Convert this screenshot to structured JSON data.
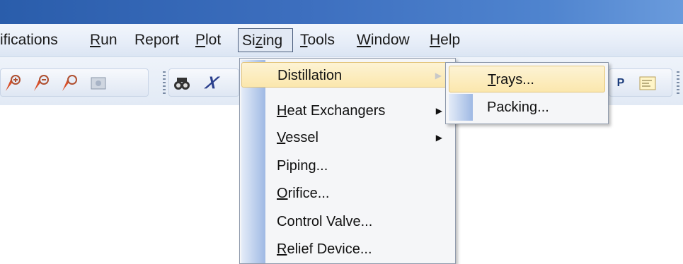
{
  "menubar": {
    "items": [
      {
        "pre": "ifications",
        "ul": "",
        "post": ""
      },
      {
        "pre": "",
        "ul": "R",
        "post": "un"
      },
      {
        "pre": "Report",
        "ul": "",
        "post": ""
      },
      {
        "pre": "",
        "ul": "P",
        "post": "lot"
      },
      {
        "pre": "Si",
        "ul": "z",
        "post": "ing"
      },
      {
        "pre": "",
        "ul": "T",
        "post": "ools"
      },
      {
        "pre": "",
        "ul": "W",
        "post": "indow"
      },
      {
        "pre": "",
        "ul": "H",
        "post": "elp"
      }
    ]
  },
  "toolbar": {
    "icons": [
      "zoom-in-icon",
      "zoom-out-icon",
      "zoom-icon",
      "screenshot-icon",
      "binoculars-icon",
      "variable-icon",
      "p-icon",
      "notes-icon"
    ]
  },
  "sizing_menu": {
    "items": [
      {
        "pre": "Distillation",
        "ul": "",
        "post": "",
        "arrow": "▶"
      },
      {
        "pre": "",
        "ul": "H",
        "post": "eat Exchangers",
        "arrow": "▶"
      },
      {
        "pre": "",
        "ul": "V",
        "post": "essel",
        "arrow": "▶"
      },
      {
        "pre": "Piping...",
        "ul": "",
        "post": "",
        "arrow": ""
      },
      {
        "pre": "",
        "ul": "O",
        "post": "rifice...",
        "arrow": ""
      },
      {
        "pre": "Control Valve...",
        "ul": "",
        "post": "",
        "arrow": ""
      },
      {
        "pre": "",
        "ul": "R",
        "post": "elief Device...",
        "arrow": ""
      }
    ]
  },
  "distillation_submenu": {
    "items": [
      {
        "pre": "",
        "ul": "T",
        "post": "rays..."
      },
      {
        "pre": "Packing...",
        "ul": "",
        "post": ""
      }
    ]
  },
  "colors": {
    "titlebar": "#2a5dab",
    "highlight": "#fbe7ad",
    "menu_bg": "#f5f6f8"
  }
}
